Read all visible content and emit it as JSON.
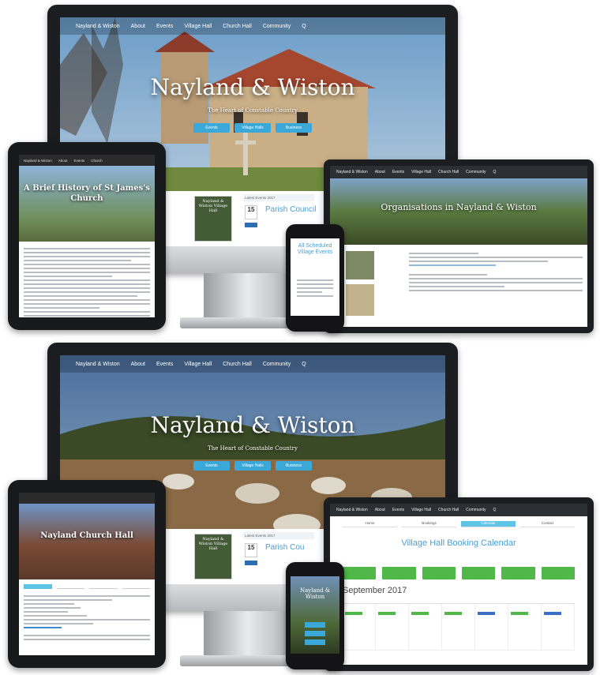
{
  "top": {
    "monitor": {
      "nav": [
        "Nayland & Wiston",
        "About",
        "Events",
        "Village Hall",
        "Church Hall",
        "Community",
        "Q"
      ],
      "title": "Nayland & Wiston",
      "subtitle": "The Heart of Constable Country",
      "buttons": [
        "Events",
        "Village Halls",
        "Business"
      ],
      "card_caption": "Nayland & Wiston Village Hall",
      "events_label": "Latest Events 2017",
      "event_day": "15",
      "section_heading": "Parish Council"
    },
    "tablet": {
      "nav": [
        "Nayland & Wiston",
        "About",
        "Events",
        "Church"
      ],
      "title": "A Brief History of St James's Church"
    },
    "laptop": {
      "nav": [
        "Nayland & Wiston",
        "About",
        "Events",
        "Village Hall",
        "Church Hall",
        "Community",
        "Q"
      ],
      "title": "Organisations in Nayland & Wiston"
    },
    "phone": {
      "title": "All Scheduled Village Events"
    }
  },
  "bottom": {
    "monitor": {
      "nav": [
        "Nayland & Wiston",
        "About",
        "Events",
        "Village Hall",
        "Church Hall",
        "Community",
        "Q"
      ],
      "title": "Nayland & Wiston",
      "subtitle": "The Heart of Constable Country",
      "buttons": [
        "Events",
        "Village Halls",
        "Business"
      ],
      "card_caption": "Nayland & Wiston Village Hall",
      "events_label": "Latest Events 2017",
      "event_day": "15",
      "section_heading": "Parish Cou"
    },
    "tablet": {
      "title": "Nayland Church Hall"
    },
    "laptop": {
      "nav": [
        "Nayland & Wiston",
        "About",
        "Events",
        "Village Hall",
        "Church Hall",
        "Community",
        "Q"
      ],
      "tabs": [
        "Home",
        "Bookings",
        "Calendar",
        "Contact"
      ],
      "calendar_title": "Village Hall Booking Calendar",
      "month": "September 2017"
    },
    "phone": {
      "title": "Nayland & Wiston"
    }
  },
  "colors": {
    "accent_blue": "#3aa8d8",
    "heading_blue": "#4c9ed2",
    "booking_green": "#4fb848",
    "device_black": "#1c1d20"
  }
}
